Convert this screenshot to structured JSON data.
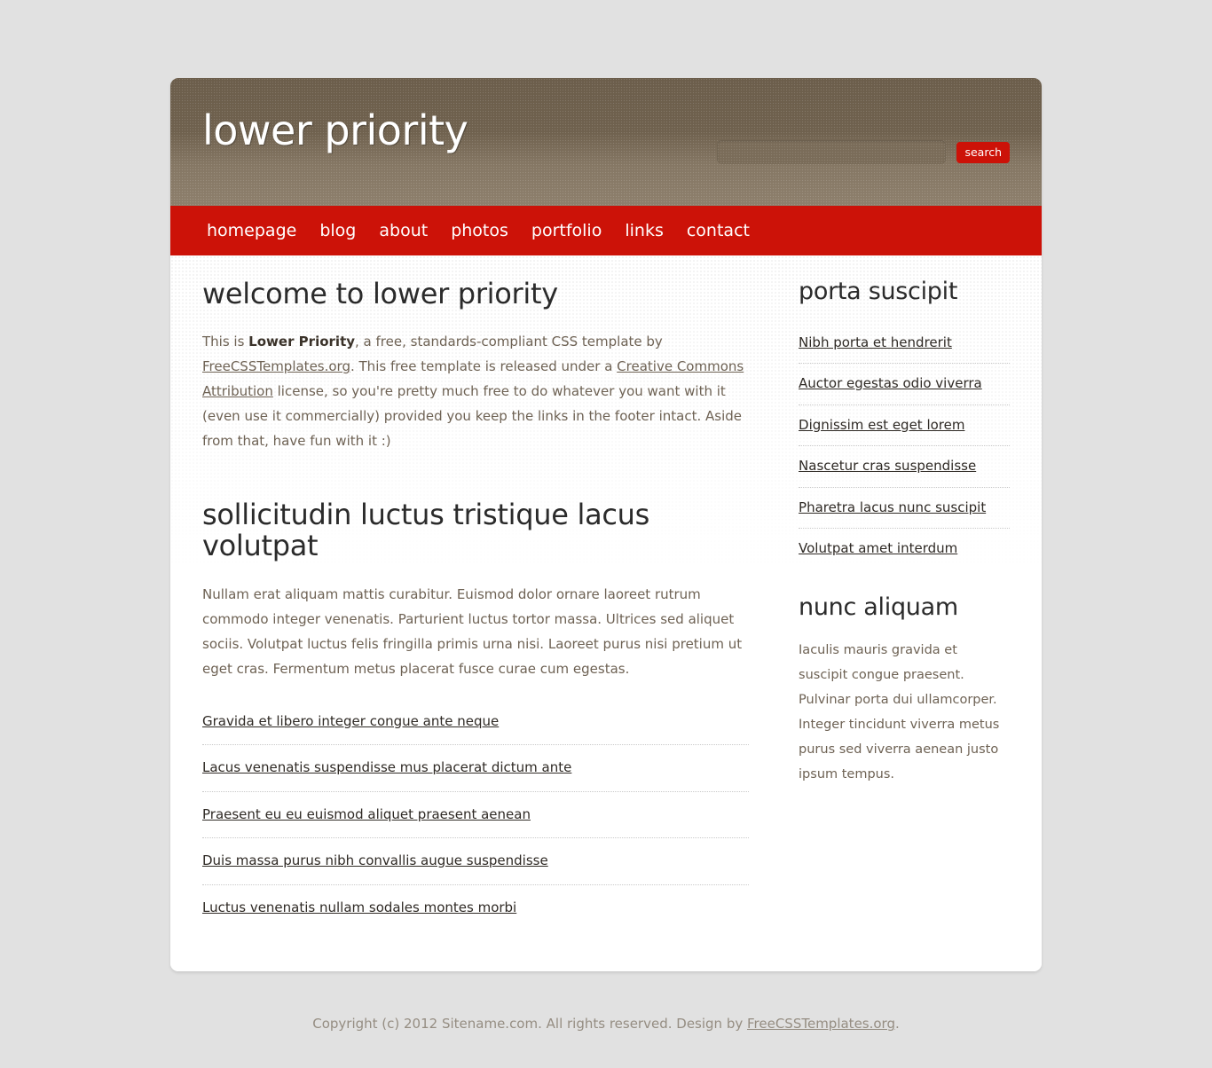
{
  "header": {
    "logo": "lower priority",
    "search": {
      "value": "",
      "placeholder": "",
      "button_label": "search"
    }
  },
  "nav": {
    "items": [
      {
        "label": "homepage"
      },
      {
        "label": "blog"
      },
      {
        "label": "about"
      },
      {
        "label": "photos"
      },
      {
        "label": "portfolio"
      },
      {
        "label": "links"
      },
      {
        "label": "contact"
      }
    ]
  },
  "content": {
    "welcome": {
      "heading": "welcome to lower priority",
      "intro_part1": "This is ",
      "intro_strong": "Lower Priority",
      "intro_part2": ", a free, standards-compliant CSS template by ",
      "intro_link1": "FreeCSSTemplates.org",
      "intro_part3": ". This free template is released under a ",
      "intro_link2": "Creative Commons Attribution",
      "intro_part4": " license, so you're pretty much free to do whatever you want with it (even use it commercially) provided you keep the links in the footer intact. Aside from that, have fun with it :)"
    },
    "section_two": {
      "heading": "sollicitudin luctus tristique lacus volutpat",
      "paragraph": "Nullam erat aliquam mattis curabitur. Euismod dolor ornare laoreet rutrum commodo integer venenatis. Parturient luctus tortor massa. Ultrices sed aliquet sociis. Volutpat luctus felis fringilla primis urna nisi. Laoreet purus nisi pretium ut eget cras. Fermentum metus placerat fusce curae cum egestas.",
      "links": [
        {
          "label": "Gravida et libero integer congue ante neque"
        },
        {
          "label": "Lacus venenatis suspendisse mus placerat dictum ante"
        },
        {
          "label": "Praesent eu eu euismod aliquet praesent aenean"
        },
        {
          "label": "Duis massa purus nibh convallis augue suspendisse"
        },
        {
          "label": "Luctus venenatis nullam sodales montes morbi"
        }
      ]
    }
  },
  "sidebar": {
    "block_one": {
      "heading": "porta suscipit",
      "links": [
        {
          "label": "Nibh porta et hendrerit"
        },
        {
          "label": "Auctor egestas odio viverra"
        },
        {
          "label": "Dignissim est eget lorem"
        },
        {
          "label": "Nascetur cras suspendisse"
        },
        {
          "label": "Pharetra lacus nunc suscipit"
        },
        {
          "label": "Volutpat amet interdum"
        }
      ]
    },
    "block_two": {
      "heading": "nunc aliquam",
      "paragraph": "Iaculis mauris gravida et suscipit congue praesent. Pulvinar porta dui ullamcorper. Integer tincidunt viverra metus purus sed viverra aenean justo ipsum tempus."
    }
  },
  "footer": {
    "text_before": "Copyright (c) 2012 Sitename.com. All rights reserved. Design by ",
    "link": "FreeCSSTemplates.org",
    "text_after": "."
  },
  "colors": {
    "accent_red": "#cc1208",
    "header_brown": "#6f614e",
    "body_text": "#6e6254",
    "page_background": "#e1e1e1"
  }
}
